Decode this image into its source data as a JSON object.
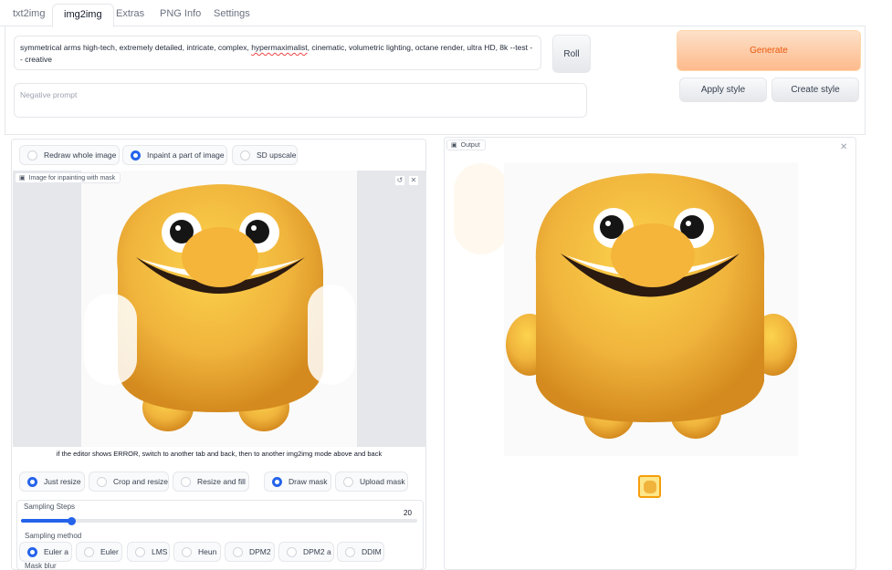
{
  "tabs": [
    "txt2img",
    "img2img",
    "Extras",
    "PNG Info",
    "Settings"
  ],
  "prompt": {
    "value_before": "symmetrical arms high-tech, extremely detailed, intricate, complex, ",
    "value_misspelled": "hypermaximalist",
    "value_after": ", cinematic, volumetric lighting, octane render, ultra HD, 8k --test -- creative",
    "negative_placeholder": "Negative prompt"
  },
  "buttons": {
    "roll": "Roll",
    "generate": "Generate",
    "apply_style": "Apply style",
    "create_style": "Create style"
  },
  "mode_options": [
    {
      "label": "Redraw whole image",
      "selected": false
    },
    {
      "label": "Inpaint a part of image",
      "selected": true
    },
    {
      "label": "SD upscale",
      "selected": false
    }
  ],
  "inpaint_label": "Image for inpainting with mask",
  "editor_notice": "if the editor shows ERROR, switch to another tab and back, then to another img2img mode above and back",
  "resize_options": [
    {
      "label": "Just resize",
      "selected": true
    },
    {
      "label": "Crop and resize",
      "selected": false
    },
    {
      "label": "Resize and fill",
      "selected": false
    }
  ],
  "mask_options": [
    {
      "label": "Draw mask",
      "selected": true
    },
    {
      "label": "Upload mask",
      "selected": false
    }
  ],
  "sampling_steps": {
    "label": "Sampling Steps",
    "value": "20",
    "min": 1,
    "max": 150
  },
  "sampling_method": {
    "label": "Sampling method",
    "options": [
      {
        "label": "Euler a",
        "selected": true
      },
      {
        "label": "Euler",
        "selected": false
      },
      {
        "label": "LMS",
        "selected": false
      },
      {
        "label": "Heun",
        "selected": false
      },
      {
        "label": "DPM2",
        "selected": false
      },
      {
        "label": "DPM2 a",
        "selected": false
      },
      {
        "label": "DDIM",
        "selected": false
      }
    ]
  },
  "mask_blur_label": "Mask blur",
  "output_label": "Output",
  "colors": {
    "accent": "#2563eb",
    "generate_text": "#ea580c",
    "character": "#f0b43c"
  }
}
